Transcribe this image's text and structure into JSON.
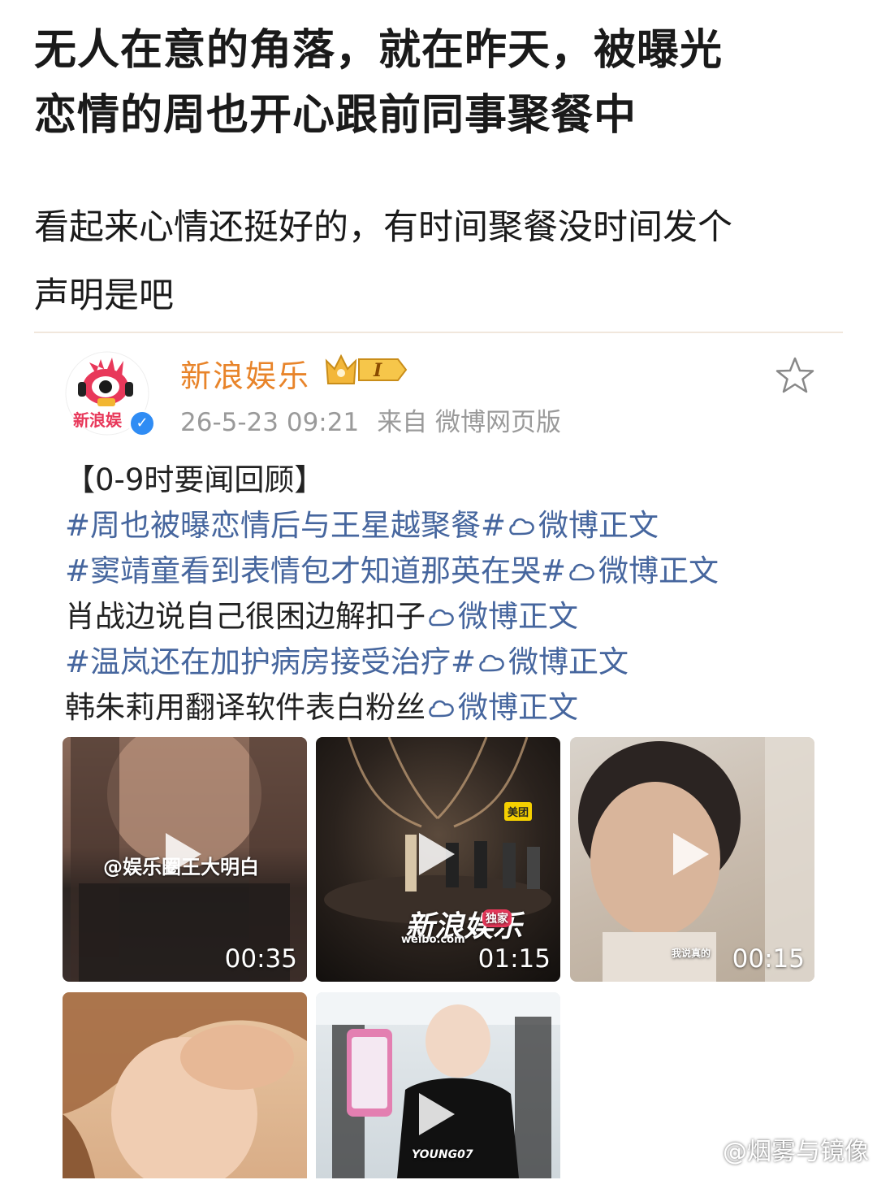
{
  "headline": {
    "line1": "无人在意的角落，就在昨天，被曝光",
    "line2": "恋情的周也开心跟前同事聚餐中"
  },
  "body": {
    "line1": "看起来心情还挺好的，有时间聚餐没时间发个",
    "line2": "声明是吧"
  },
  "post": {
    "author": "新浪娱乐",
    "avatar_text": "新浪娱",
    "badge_level": "I",
    "timestamp": "26-5-23 09:21",
    "source": "来自 微博网页版",
    "heading": "【0-9时要闻回顾】",
    "link_text": "微博正文",
    "items": [
      {
        "prefix": "#周也被曝恋情后与王星越聚餐#",
        "is_tag": true
      },
      {
        "prefix": "#窦靖童看到表情包才知道那英在哭#",
        "is_tag": true
      },
      {
        "prefix": "肖战边说自己很困边解扣子",
        "is_tag": false
      },
      {
        "prefix": "#温岚还在加护病房接受治疗#",
        "is_tag": true
      },
      {
        "prefix": "韩朱莉用翻译软件表白粉丝",
        "is_tag": false
      }
    ],
    "videos": [
      {
        "duration": "00:35",
        "overlay": "@娱乐圈王大明白"
      },
      {
        "duration": "01:15",
        "overlay": "新浪娱乐",
        "sub_overlay": "weibo.com",
        "tag": "独家",
        "corner": "美团"
      },
      {
        "duration": "00:15",
        "overlay": "我说真的"
      },
      {
        "duration": "",
        "overlay": ""
      },
      {
        "duration": "",
        "overlay": "YOUNG07"
      }
    ]
  },
  "watermark": "@烟雾与镜像",
  "colors": {
    "tag": "#46669e",
    "author": "#e8842a",
    "meta": "#9a9a9a",
    "verified": "#2f8cf4"
  }
}
